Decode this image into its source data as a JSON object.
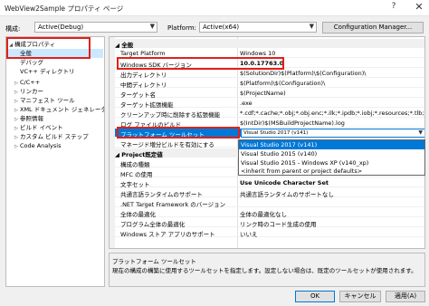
{
  "window": {
    "title": "WebView2Sample プロパティ ページ",
    "help": "?",
    "close": "✕"
  },
  "toolbar": {
    "config_label": "構成:",
    "config_value": "Active(Debug)",
    "platform_label": "Platform:",
    "platform_value": "Active(x64)",
    "config_manager": "Configuration Manager..."
  },
  "tree": [
    {
      "label": "構成プロパティ",
      "twisty": "◢",
      "indent": 0
    },
    {
      "label": "全般",
      "twisty": "",
      "indent": 1,
      "selected": true
    },
    {
      "label": "デバッグ",
      "twisty": "",
      "indent": 1
    },
    {
      "label": "VC++ ディレクトリ",
      "twisty": "",
      "indent": 1
    },
    {
      "label": "C/C++",
      "twisty": "▷",
      "indent": 1
    },
    {
      "label": "リンカー",
      "twisty": "▷",
      "indent": 1
    },
    {
      "label": "マニフェスト ツール",
      "twisty": "▷",
      "indent": 1
    },
    {
      "label": "XML ドキュメント ジェネレーター",
      "twisty": "▷",
      "indent": 1
    },
    {
      "label": "参照情報",
      "twisty": "▷",
      "indent": 1
    },
    {
      "label": "ビルド イベント",
      "twisty": "▷",
      "indent": 1
    },
    {
      "label": "カスタム ビルド ステップ",
      "twisty": "▷",
      "indent": 1
    },
    {
      "label": "Code Analysis",
      "twisty": "▷",
      "indent": 1
    }
  ],
  "grid": {
    "cat_general": "全般",
    "cat_defaults": "Project既定値",
    "rows": [
      {
        "name": "Target Platform",
        "value": "Windows 10"
      },
      {
        "name": "Windows SDK バージョン",
        "value": "10.0.17763.0"
      },
      {
        "name": "出力ディレクトリ",
        "value": "$(SolutionDir)$(Platform)\\$(Configuration)\\"
      },
      {
        "name": "中間ディレクトリ",
        "value": "$(Platform)\\$(Configuration)\\"
      },
      {
        "name": "ターゲット名",
        "value": "$(ProjectName)"
      },
      {
        "name": "ターゲット拡張機能",
        "value": ".exe"
      },
      {
        "name": "クリーンアップ時に削除する拡張機能",
        "value": "*.cdf;*.cache;*.obj;*.obj.enc;*.ilk;*.ipdb;*.iobj;*.resources;*.tlb;*.tli;"
      },
      {
        "name": "ログ ファイルのビルド",
        "value": "$(IntDir)$(MSBuildProjectName).log"
      },
      {
        "name": "プラットフォーム ツールセット",
        "value": "Visual Studio 2017 (v141)"
      },
      {
        "name": "マネージド増分ビルドを有効にする",
        "value": ""
      }
    ],
    "rows2": [
      {
        "name": "構成の種類",
        "value": ""
      },
      {
        "name": "MFC の使用",
        "value": ""
      },
      {
        "name": "文字セット",
        "value": "Use Unicode Character Set"
      },
      {
        "name": "共通言語ランタイムのサポート",
        "value": "共通言語ランタイムのサポートなし"
      },
      {
        "name": ".NET Target Framework のバージョン",
        "value": ""
      },
      {
        "name": "全体の最適化",
        "value": "全体の最適化なし"
      },
      {
        "name": "プログラム全体の最適化",
        "value": "リンク時のコード生成の使用"
      },
      {
        "name": "Windows ストア アプリのサポート",
        "value": "いいえ"
      }
    ]
  },
  "dropdown": {
    "items": [
      "Visual Studio 2017 (v141)",
      "Visual Studio 2015 (v140)",
      "Visual Studio 2015 - Windows XP (v140_xp)",
      "<inherit from parent or project defaults>"
    ]
  },
  "description": {
    "title": "プラットフォーム ツールセット",
    "text": "現在の構成の構築に使用するツールセットを指定します。設定しない場合は、既定のツールセットが使用されます。"
  },
  "buttons": {
    "ok": "OK",
    "cancel": "キャンセル",
    "apply": "適用(A)"
  },
  "colors": {
    "highlight": "#e0201a",
    "selection": "#0078d7"
  }
}
